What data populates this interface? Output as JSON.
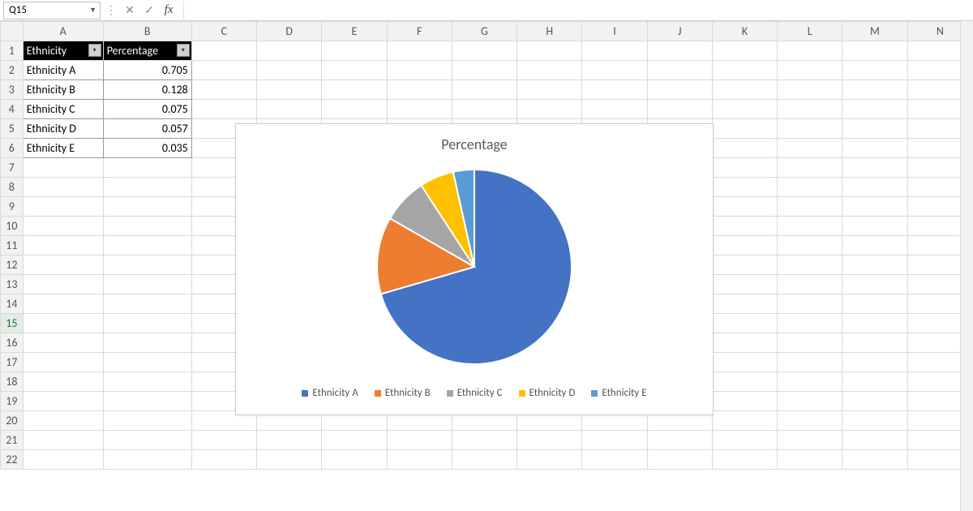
{
  "formula_bar": {
    "cell_ref": "Q15",
    "formula": ""
  },
  "columns": [
    "A",
    "B",
    "C",
    "D",
    "E",
    "F",
    "G",
    "H",
    "I",
    "J",
    "K",
    "L",
    "M",
    "N"
  ],
  "row_count": 22,
  "selected_row": 15,
  "table": {
    "headers": {
      "col_a": "Ethnicity",
      "col_b": "Percentage"
    },
    "rows": [
      {
        "label": "Ethnicity A",
        "value": "0.705"
      },
      {
        "label": "Ethnicity B",
        "value": "0.128"
      },
      {
        "label": "Ethnicity C",
        "value": "0.075"
      },
      {
        "label": "Ethnicity D",
        "value": "0.057"
      },
      {
        "label": "Ethnicity E",
        "value": "0.035"
      }
    ]
  },
  "chart_data": {
    "type": "pie",
    "title": "Percentage",
    "categories": [
      "Ethnicity A",
      "Ethnicity B",
      "Ethnicity C",
      "Ethnicity D",
      "Ethnicity E"
    ],
    "values": [
      0.705,
      0.128,
      0.075,
      0.057,
      0.035
    ],
    "colors": [
      "#4472c4",
      "#ed7d31",
      "#a5a5a5",
      "#ffc000",
      "#5b9bd5"
    ],
    "legend_position": "bottom"
  }
}
